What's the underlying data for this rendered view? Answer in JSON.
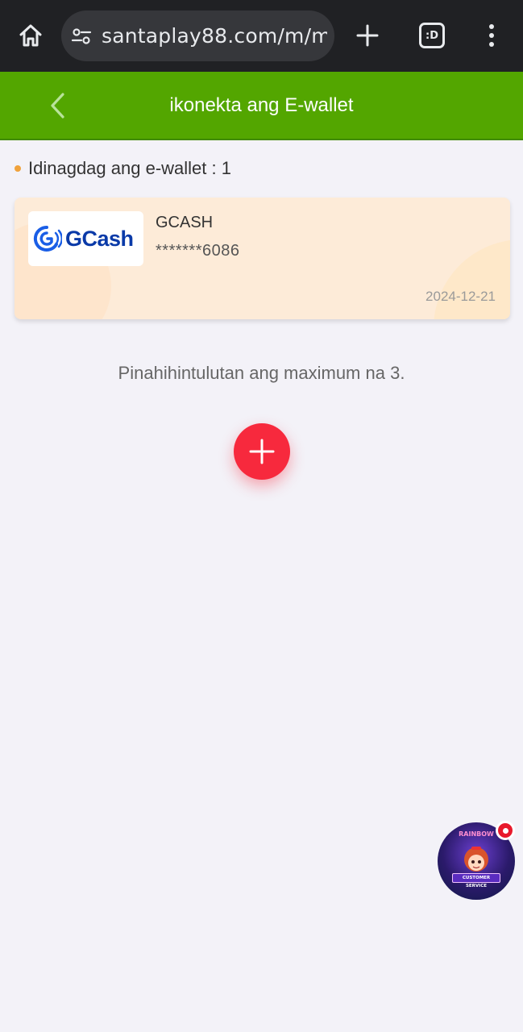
{
  "browser": {
    "url": "santaplay88.com/m/m",
    "tabs_label": ":D"
  },
  "header": {
    "title": "ikonekta ang E-wallet"
  },
  "wallets": {
    "count_label": "Idinagdag ang e-wallet : 1",
    "items": [
      {
        "logo_text": "GCash",
        "name": "GCASH",
        "account": "*******6086",
        "date": "2024-12-21"
      }
    ],
    "max_note": "Pinahihintulutan ang maximum na 3."
  },
  "customer_service": {
    "label": "CUSTOMER SERVICE",
    "badge_title": "RAINBOW"
  },
  "colors": {
    "header_green": "#53a600",
    "add_red": "#f7293d",
    "dot_orange": "#f0a23c",
    "gcash_blue": "#0a3aa8"
  },
  "icons": {
    "home": "home-icon",
    "site_settings": "tune-icon",
    "new_tab": "plus-icon",
    "menu": "more-vert-icon",
    "back": "chevron-left-icon",
    "add": "plus-icon"
  }
}
